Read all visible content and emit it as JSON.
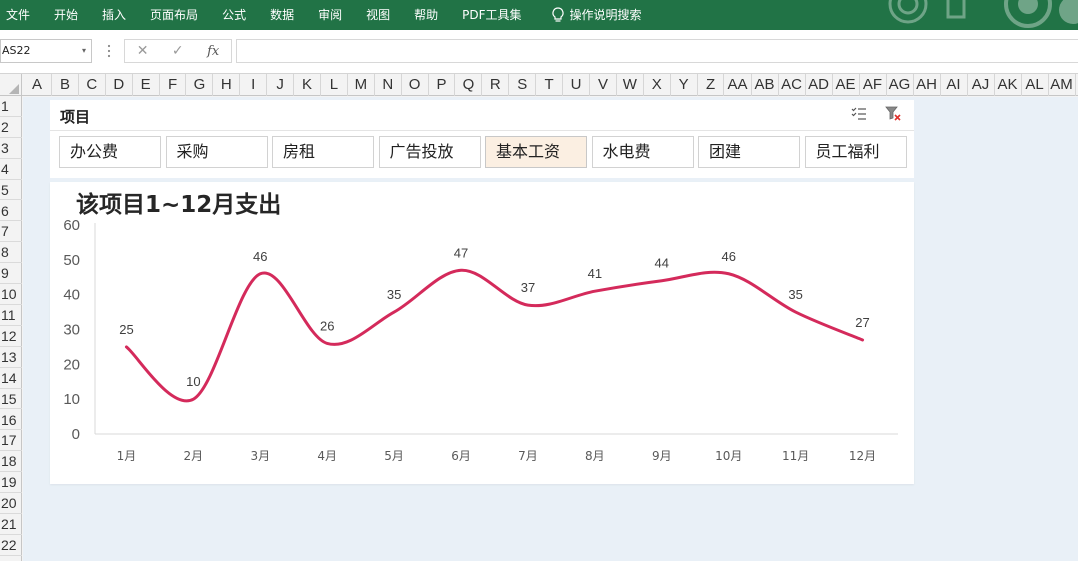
{
  "ribbon": {
    "tabs": [
      "文件",
      "开始",
      "插入",
      "页面布局",
      "公式",
      "数据",
      "审阅",
      "视图",
      "帮助",
      "PDF工具集"
    ],
    "tellme": "操作说明搜索",
    "color": "#217346"
  },
  "formula_bar": {
    "name_box": "AS22",
    "cancel": "✕",
    "enter": "✓",
    "fx": "fx",
    "value": ""
  },
  "columns": [
    "A",
    "B",
    "C",
    "D",
    "E",
    "F",
    "G",
    "H",
    "I",
    "J",
    "K",
    "L",
    "M",
    "N",
    "O",
    "P",
    "Q",
    "R",
    "S",
    "T",
    "U",
    "V",
    "W",
    "X",
    "Y",
    "Z",
    "AA",
    "AB",
    "AC",
    "AD",
    "AE",
    "AF",
    "AG",
    "AH",
    "AI",
    "AJ",
    "AK",
    "AL",
    "AM"
  ],
  "rows": [
    "1",
    "2",
    "3",
    "4",
    "5",
    "6",
    "7",
    "8",
    "9",
    "10",
    "11",
    "12",
    "13",
    "14",
    "15",
    "16",
    "17",
    "18",
    "19",
    "20",
    "21",
    "22"
  ],
  "slicer": {
    "title": "项目",
    "items": [
      "办公费",
      "采购",
      "房租",
      "广告投放",
      "基本工资",
      "水电费",
      "团建",
      "员工福利"
    ],
    "selected": "基本工资",
    "icons": [
      "multi-select-icon",
      "clear-filter-icon"
    ]
  },
  "chart_data": {
    "type": "line",
    "title": "该项目1~12月支出",
    "categories": [
      "1月",
      "2月",
      "3月",
      "4月",
      "5月",
      "6月",
      "7月",
      "8月",
      "9月",
      "10月",
      "11月",
      "12月"
    ],
    "values": [
      25,
      10,
      46,
      26,
      35,
      47,
      37,
      41,
      44,
      46,
      35,
      27
    ],
    "ylim": [
      0,
      60
    ],
    "yticks": [
      0,
      10,
      20,
      30,
      40,
      50,
      60
    ],
    "smooth": true,
    "grid": false,
    "data_labels": true,
    "line_color": "#d42a5b"
  }
}
